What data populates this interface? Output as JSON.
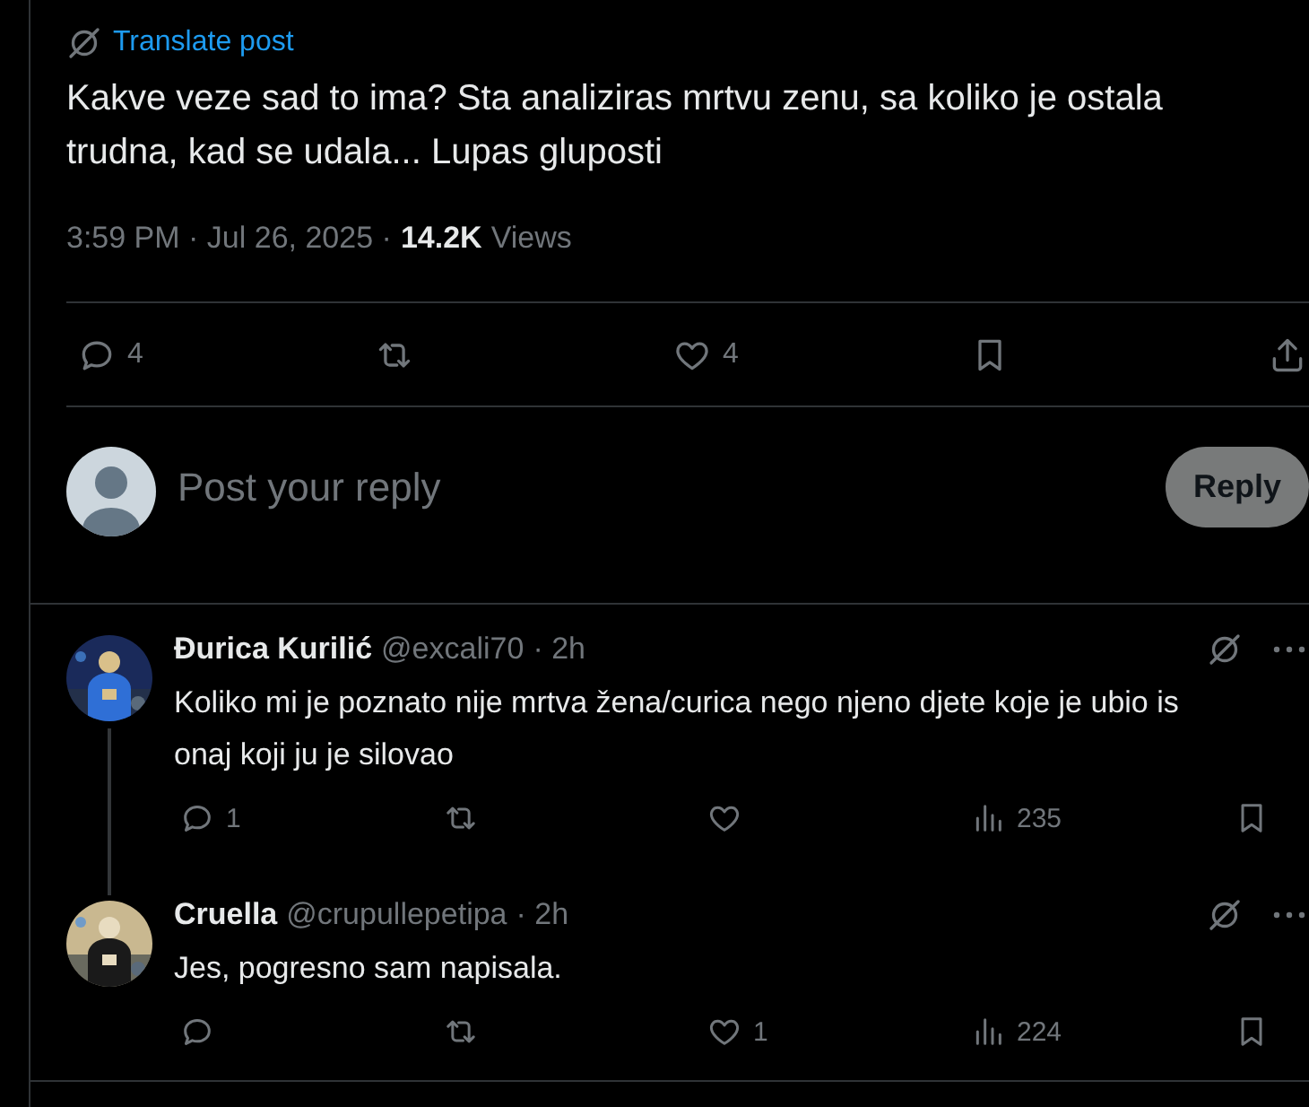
{
  "post": {
    "translate_link": "Translate post",
    "text": "Kakve veze sad to ima? Sta analiziras mrtvu zenu, sa koliko je ostala trudna, kad se udala... Lupas gluposti",
    "timestamp": "3:59 PM · Jul 26, 2025 ·",
    "views_count": "14.2K",
    "views_label": "Views",
    "actions": [
      {
        "kind": "reply",
        "count": "4"
      },
      {
        "kind": "repost"
      },
      {
        "kind": "like",
        "count": "4"
      },
      {
        "kind": "bookmark"
      },
      {
        "kind": "share"
      }
    ]
  },
  "composer": {
    "placeholder": "Post your reply",
    "button": "Reply",
    "disabled": true
  },
  "replies": [
    {
      "name": "Đurica Kurilić",
      "handle": "@excali70",
      "age": "· 2h",
      "text": "Koliko mi je poznato nije mrtva žena/curica nego njeno djete koje je ubio is\nonaj koji ju je silovao",
      "thread_line": true,
      "actions": [
        {
          "kind": "reply",
          "count": "1"
        },
        {
          "kind": "repost"
        },
        {
          "kind": "like"
        },
        {
          "kind": "views",
          "count": "235"
        },
        {
          "kind": "bookmark"
        }
      ]
    },
    {
      "name": "Cruella",
      "handle": "@crupullepetipa",
      "age": "· 2h",
      "text": "Jes, pogresno sam napisala.",
      "thread_line": false,
      "actions": [
        {
          "kind": "reply"
        },
        {
          "kind": "repost"
        },
        {
          "kind": "like",
          "count": "1"
        },
        {
          "kind": "views",
          "count": "224"
        },
        {
          "kind": "bookmark"
        }
      ]
    }
  ]
}
